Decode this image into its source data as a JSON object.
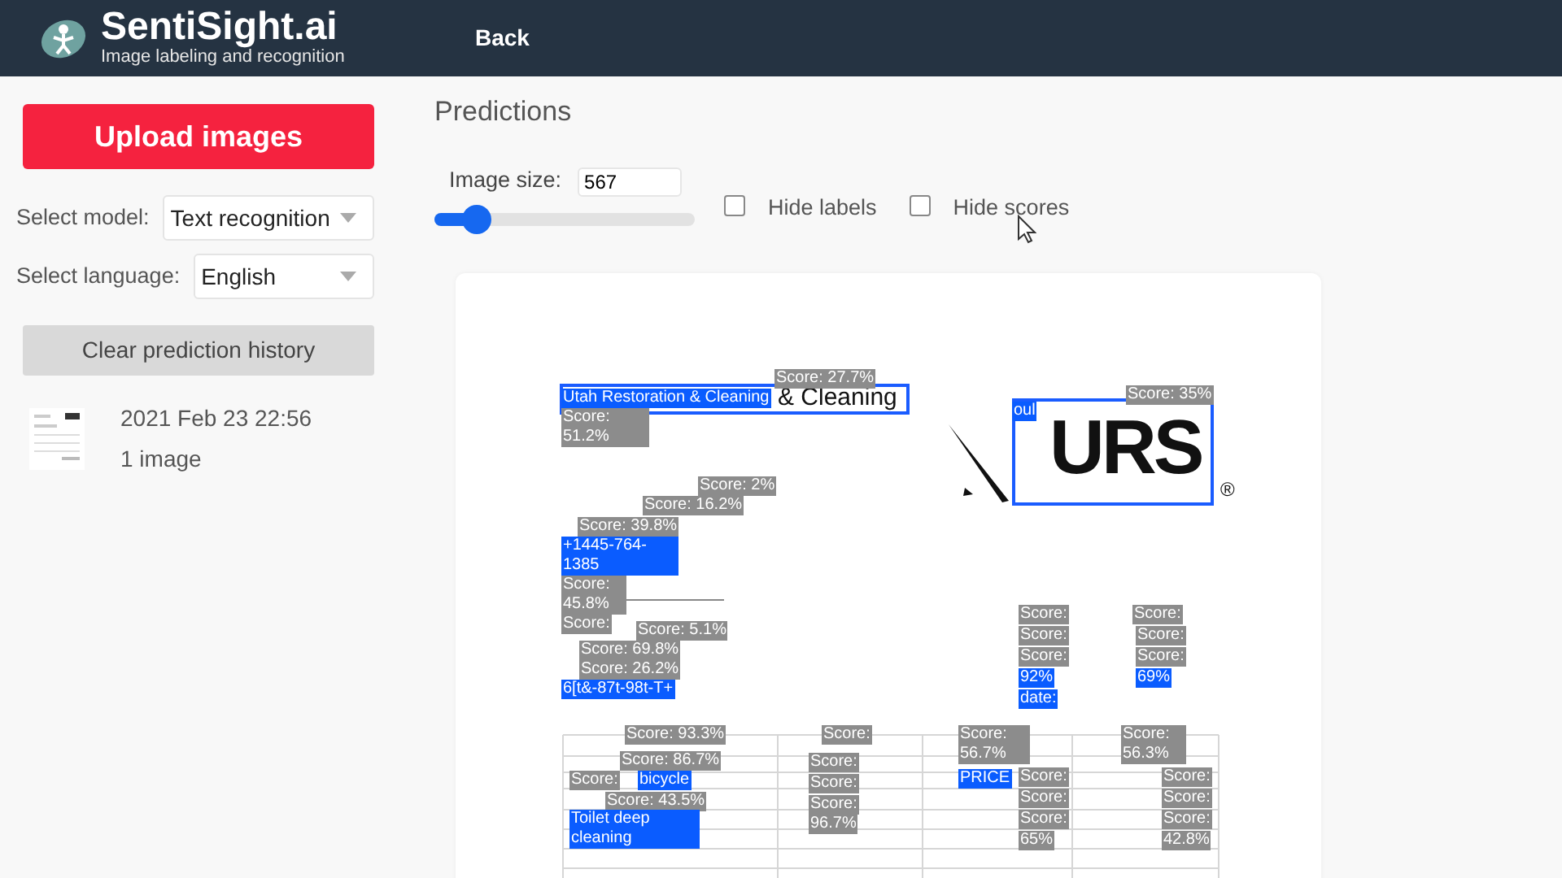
{
  "header": {
    "brand": "SentiSight.ai",
    "tagline": "Image labeling and recognition",
    "back": "Back"
  },
  "sidebar": {
    "upload": "Upload images",
    "selects": [
      {
        "label": "Select model:",
        "value": "Text recognition"
      },
      {
        "label": "Select language:",
        "value": "English"
      }
    ],
    "clear": "Clear prediction history",
    "history": [
      {
        "date": "2021 Feb 23 22:56",
        "count": "1 image"
      }
    ]
  },
  "main": {
    "title": "Predictions",
    "image_size": {
      "label": "Image size:",
      "value": "567",
      "level": 0.16
    },
    "options": [
      {
        "label": "Hide labels",
        "checked": false
      },
      {
        "label": "Hide scores",
        "checked": false
      }
    ],
    "document": {
      "texts": [
        "& Cleaning",
        "URS",
        "®"
      ]
    },
    "annotations": [
      {
        "text": "Score: 27.7%",
        "kind": "score"
      },
      {
        "text": "Utah Restoration & Cleaning",
        "kind": "label"
      },
      {
        "text": "Score: 51.2%",
        "kind": "score"
      },
      {
        "text": "Score: 2%",
        "kind": "score"
      },
      {
        "text": "Score: 16.2%",
        "kind": "score"
      },
      {
        "text": "Score: 39.8%",
        "kind": "score"
      },
      {
        "text": "+1445-764-1385",
        "kind": "label"
      },
      {
        "text": "Score: 45.8%",
        "kind": "score"
      },
      {
        "text": "Score:",
        "kind": "score"
      },
      {
        "text": "Score: 5.1%",
        "kind": "score"
      },
      {
        "text": "Score: 69.8%",
        "kind": "score"
      },
      {
        "text": "Score: 26.2%",
        "kind": "score"
      },
      {
        "text": "6[t&-87t-98t-T+",
        "kind": "label"
      },
      {
        "text": "Score: 35%",
        "kind": "score"
      },
      {
        "text": "oul",
        "kind": "label"
      },
      {
        "text": "Score:",
        "kind": "score"
      },
      {
        "text": "Score:",
        "kind": "score"
      },
      {
        "text": "Score:",
        "kind": "score"
      },
      {
        "text": "92%",
        "kind": "label"
      },
      {
        "text": "date:",
        "kind": "label"
      },
      {
        "text": "Score:",
        "kind": "score"
      },
      {
        "text": "Score:",
        "kind": "score"
      },
      {
        "text": "Score:",
        "kind": "score"
      },
      {
        "text": "69%",
        "kind": "label"
      },
      {
        "text": "Score: 93.3%",
        "kind": "score"
      },
      {
        "text": "Score: 86.7%",
        "kind": "score"
      },
      {
        "text": "Score:",
        "kind": "score"
      },
      {
        "text": "bicycle",
        "kind": "label"
      },
      {
        "text": "Score: 43.5%",
        "kind": "score"
      },
      {
        "text": "Toilet deep cleaning",
        "kind": "label"
      },
      {
        "text": "Score:",
        "kind": "score"
      },
      {
        "text": "Score:",
        "kind": "score"
      },
      {
        "text": "Score:",
        "kind": "score"
      },
      {
        "text": "Score:",
        "kind": "score"
      },
      {
        "text": "96.7%",
        "kind": "score"
      },
      {
        "text": "Score: 56.7%",
        "kind": "score"
      },
      {
        "text": "PRICE",
        "kind": "label"
      },
      {
        "text": "Score:",
        "kind": "score"
      },
      {
        "text": "Score:",
        "kind": "score"
      },
      {
        "text": "Score:",
        "kind": "score"
      },
      {
        "text": "65%",
        "kind": "score"
      },
      {
        "text": "Score: 56.3%",
        "kind": "score"
      },
      {
        "text": "Score:",
        "kind": "score"
      },
      {
        "text": "Score:",
        "kind": "score"
      },
      {
        "text": "Score:",
        "kind": "score"
      },
      {
        "text": "42.8%",
        "kind": "score"
      }
    ]
  }
}
